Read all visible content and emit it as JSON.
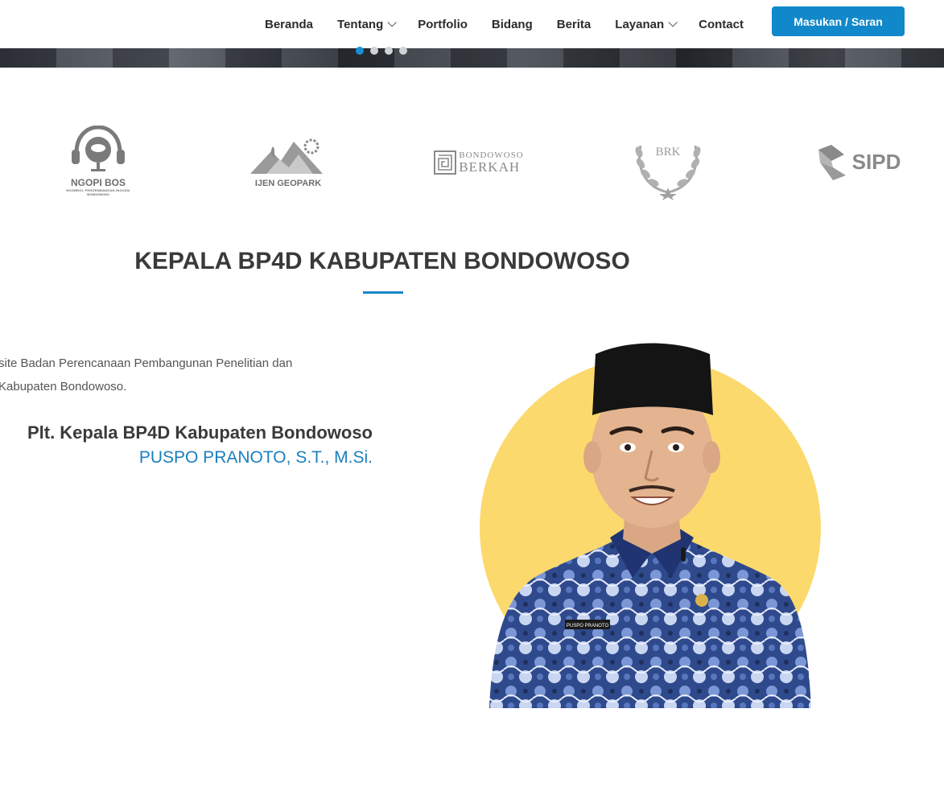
{
  "hero": {
    "slides": [
      {
        "index": 1,
        "active": true
      },
      {
        "index": 2,
        "active": false
      },
      {
        "index": 3,
        "active": false
      },
      {
        "index": 4,
        "active": false
      }
    ]
  },
  "nav": {
    "items": [
      {
        "label": "Beranda",
        "has_dropdown": false
      },
      {
        "label": "Tentang",
        "has_dropdown": true
      },
      {
        "label": "Portfolio",
        "has_dropdown": false
      },
      {
        "label": "Bidang",
        "has_dropdown": false
      },
      {
        "label": "Berita",
        "has_dropdown": false
      },
      {
        "label": "Layanan",
        "has_dropdown": true
      },
      {
        "label": "Contact",
        "has_dropdown": false
      }
    ],
    "cta_label": "Masukan / Saran"
  },
  "partners": {
    "logos": [
      {
        "name": "ngopi-bos",
        "title": "NGOPI BOS",
        "subtitle": "NGOBROL PENGEMBANGAN INOVASI",
        "subtitle2": "BONDOWOSO"
      },
      {
        "name": "ijen-geopark",
        "title": "IJEN GEOPARK"
      },
      {
        "name": "bondowoso-berkah",
        "title": "BONDOWOSO",
        "subtitle": "BERKAH"
      },
      {
        "name": "brk",
        "title": "BRK"
      },
      {
        "name": "sipd",
        "title": "SIPD"
      }
    ]
  },
  "section": {
    "title": "KEPALA BP4D KABUPATEN BONDOWOSO"
  },
  "welcome": {
    "line1": "site Badan Perencanaan Pembangunan Penelitian dan",
    "line2": "Kabupaten Bondowoso."
  },
  "head": {
    "role": "Plt. Kepala BP4D Kabupaten Bondowoso",
    "name": "PUSPO PRANOTO, S.T., M.Si.",
    "badge_text": "PUSPO PRANOTO"
  },
  "colors": {
    "accent": "#1188c9",
    "name_blue": "#1a7fbf",
    "circle": "#fcd96c"
  }
}
